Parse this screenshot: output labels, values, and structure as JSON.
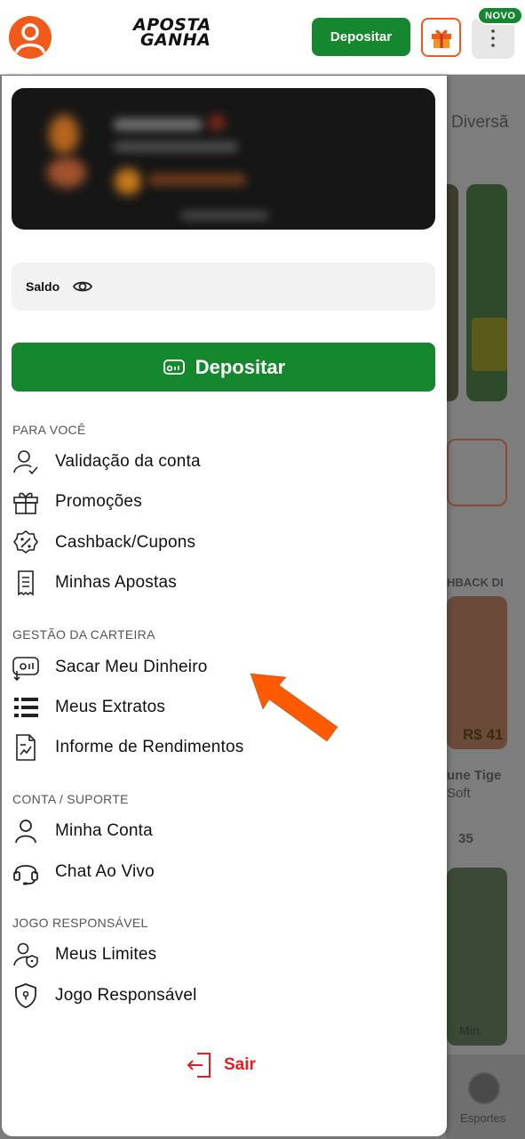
{
  "header": {
    "logo_line1": "APOSTA",
    "logo_line2": "GANHA",
    "deposit_label": "Depositar",
    "badge": "NOVO"
  },
  "background": {
    "heading_partial": "Diversã",
    "cashback_partial": "HBACK DI",
    "amount_partial": "R$ 41",
    "game_title_partial": "une Tige",
    "provider_partial": "Soft",
    "count": "35",
    "min_partial": "Min.",
    "nav_label": "Esportes"
  },
  "drawer": {
    "saldo_label": "Saldo",
    "deposit_label": "Depositar",
    "sections": [
      {
        "title": "PARA VOCÊ",
        "items": [
          {
            "label": "Validação da conta",
            "icon": "user-check-icon"
          },
          {
            "label": "Promoções",
            "icon": "gift-icon"
          },
          {
            "label": "Cashback/Cupons",
            "icon": "discount-badge-icon"
          },
          {
            "label": "Minhas Apostas",
            "icon": "receipt-icon"
          }
        ]
      },
      {
        "title": "GESTÃO DA CARTEIRA",
        "items": [
          {
            "label": "Sacar Meu Dinheiro",
            "icon": "withdraw-icon"
          },
          {
            "label": "Meus Extratos",
            "icon": "list-icon"
          },
          {
            "label": "Informe de Rendimentos",
            "icon": "report-icon"
          }
        ]
      },
      {
        "title": "CONTA / SUPORTE",
        "items": [
          {
            "label": "Minha Conta",
            "icon": "user-icon"
          },
          {
            "label": "Chat Ao Vivo",
            "icon": "headset-icon"
          }
        ]
      },
      {
        "title": "JOGO RESPONSÁVEL",
        "items": [
          {
            "label": "Meus Limites",
            "icon": "user-shield-icon"
          },
          {
            "label": "Jogo Responsável",
            "icon": "shield-icon"
          }
        ]
      }
    ],
    "logout_label": "Sair"
  },
  "colors": {
    "brand_green": "#15872e",
    "brand_orange": "#f05a1a",
    "logout_red": "#e41e1e",
    "annotation_arrow": "#ff5a00"
  }
}
